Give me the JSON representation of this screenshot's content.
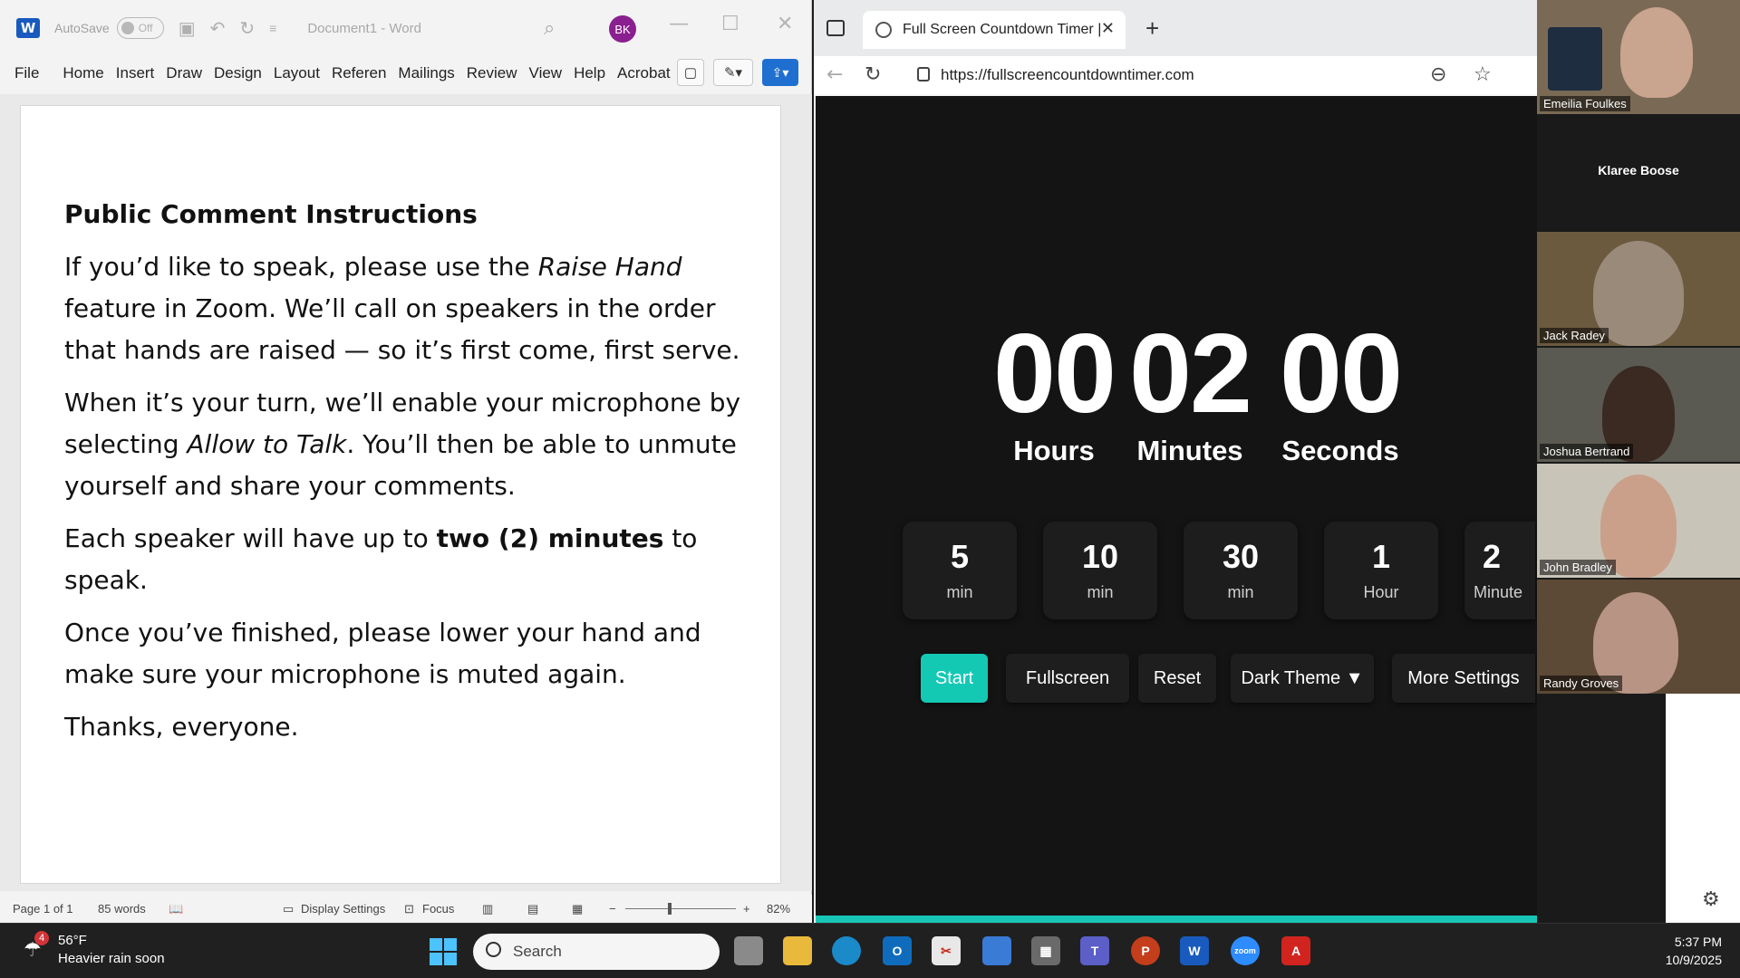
{
  "word": {
    "autosave_label": "AutoSave",
    "autosave_state": "Off",
    "doc_title": "Document1 - Word",
    "avatar_initials": "BK",
    "tabs": [
      "File",
      "Home",
      "Insert",
      "Draw",
      "Design",
      "Layout",
      "Referen",
      "Mailings",
      "Review",
      "View",
      "Help",
      "Acrobat"
    ],
    "document": {
      "heading": "Public Comment Instructions",
      "p1_a": "If you’d like to speak, please use the ",
      "p1_em": "Raise Hand",
      "p1_b": " feature in Zoom. We’ll call on speakers in the order that hands are raised — so it’s first come, first serve.",
      "p2_a": "When it’s your turn, we’ll enable your microphone by selecting ",
      "p2_em": "Allow to Talk",
      "p2_b": ". You’ll then be able to unmute yourself and share your comments.",
      "p3_a": "Each speaker will have up to ",
      "p3_strong": "two (2) minutes",
      "p3_b": " to speak.",
      "p4": "Once you’ve finished, please lower your hand and make sure your microphone is muted again.",
      "p5": "Thanks, everyone."
    },
    "status": {
      "page": "Page 1 of 1",
      "words": "85 words",
      "display_settings": "Display Settings",
      "focus": "Focus",
      "zoom": "82%"
    }
  },
  "browser": {
    "tab_title": "Full Screen Countdown Timer | Pr",
    "url": "https://fullscreencountdowntimer.com",
    "timer": {
      "hours": "00",
      "minutes": "02",
      "seconds": "00",
      "hours_label": "Hours",
      "minutes_label": "Minutes",
      "seconds_label": "Seconds"
    },
    "presets": [
      {
        "value": "5",
        "unit": "min"
      },
      {
        "value": "10",
        "unit": "min"
      },
      {
        "value": "30",
        "unit": "min"
      },
      {
        "value": "1",
        "unit": "Hour"
      },
      {
        "value": "2",
        "unit": "Minute"
      }
    ],
    "controls": {
      "start": "Start",
      "fullscreen": "Fullscreen",
      "reset": "Reset",
      "theme": "Dark Theme ▼",
      "more": "More Settings"
    },
    "accent_color": "#14c9b4"
  },
  "zoom": {
    "participants": [
      "Emeilia Foulkes",
      "Klaree Boose",
      "Jack Radey",
      "Joshua Bertrand",
      "John Bradley",
      "Randy Groves"
    ]
  },
  "taskbar": {
    "weather_badge": "4",
    "temperature": "56°F",
    "condition": "Heavier rain soon",
    "search_placeholder": "Search",
    "time": "5:37 PM",
    "date": "10/9/2025"
  }
}
